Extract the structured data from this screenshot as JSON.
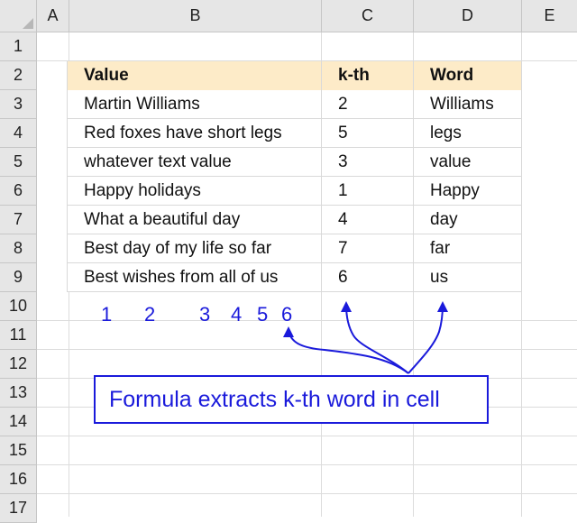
{
  "column_headers": [
    "A",
    "B",
    "C",
    "D",
    "E"
  ],
  "row_numbers": [
    "1",
    "2",
    "3",
    "4",
    "5",
    "6",
    "7",
    "8",
    "9",
    "10",
    "11",
    "12",
    "13",
    "14",
    "15",
    "16",
    "17"
  ],
  "table": {
    "headers": [
      "Value",
      "k-th",
      "Word"
    ],
    "rows": [
      [
        "Martin Williams",
        "2",
        "Williams"
      ],
      [
        "Red foxes have short legs",
        "5",
        "legs"
      ],
      [
        "whatever text value",
        "3",
        "value"
      ],
      [
        "Happy holidays",
        "1",
        "Happy"
      ],
      [
        "What a beautiful day",
        "4",
        "day"
      ],
      [
        "Best day of my life so far",
        "7",
        "far"
      ],
      [
        "Best wishes from all of us",
        "6",
        "us"
      ]
    ]
  },
  "word_numbers": [
    "1",
    "2",
    "3",
    "4",
    "5",
    "6"
  ],
  "callout": {
    "text": "Formula extracts k-th word in cell"
  },
  "colors": {
    "header_fill": "#fdebc8",
    "annotation_blue": "#1a1adb",
    "chrome": "#e6e6e6"
  }
}
